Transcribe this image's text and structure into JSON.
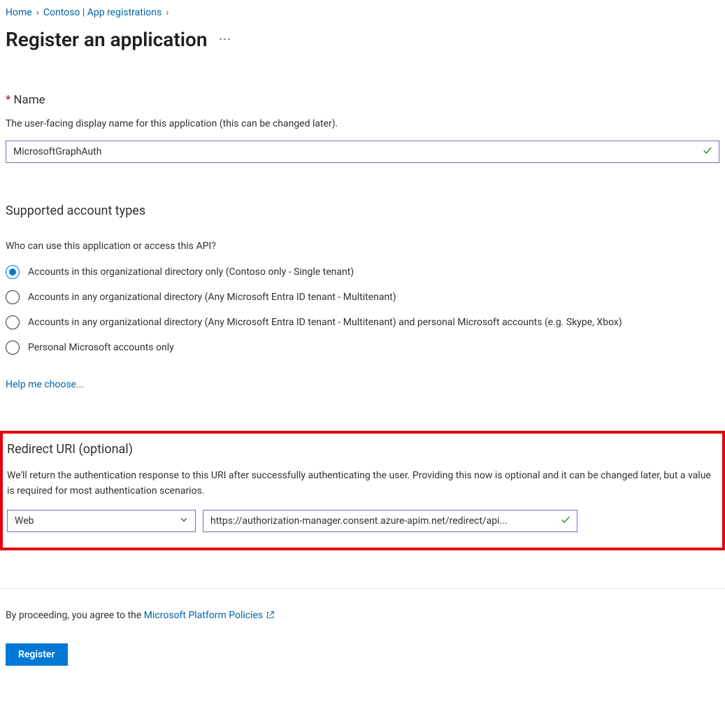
{
  "breadcrumb": {
    "items": [
      {
        "label": "Home",
        "link": true
      },
      {
        "label": "Contoso | App registrations",
        "link": true
      }
    ]
  },
  "page_title": "Register an application",
  "name_section": {
    "label": "Name",
    "description": "The user-facing display name for this application (this can be changed later).",
    "value": "MicrosoftGraphAuth"
  },
  "account_types": {
    "heading": "Supported account types",
    "question": "Who can use this application or access this API?",
    "options": [
      {
        "label": "Accounts in this organizational directory only (Contoso only - Single tenant)",
        "selected": true
      },
      {
        "label": "Accounts in any organizational directory (Any Microsoft Entra ID tenant - Multitenant)",
        "selected": false
      },
      {
        "label": "Accounts in any organizational directory (Any Microsoft Entra ID tenant - Multitenant) and personal Microsoft accounts (e.g. Skype, Xbox)",
        "selected": false
      },
      {
        "label": "Personal Microsoft accounts only",
        "selected": false
      }
    ],
    "help_link": "Help me choose..."
  },
  "redirect": {
    "heading": "Redirect URI (optional)",
    "description": "We'll return the authentication response to this URI after successfully authenticating the user. Providing this now is optional and it can be changed later, but a value is required for most authentication scenarios.",
    "platform": "Web",
    "uri": "https://authorization-manager.consent.azure-apim.net/redirect/api..."
  },
  "footer": {
    "agree_prefix": "By proceeding, you agree to the ",
    "policies_link": "Microsoft Platform Policies",
    "register_label": "Register"
  }
}
